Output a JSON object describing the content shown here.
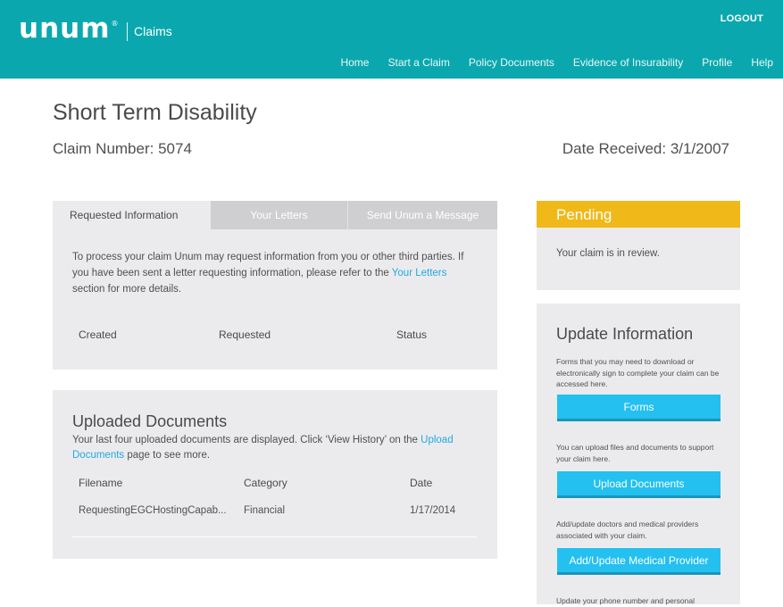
{
  "header": {
    "logo_text": "unum",
    "logo_mark": "®",
    "app_name": "Claims",
    "logout": "LOGOUT",
    "nav": [
      "Home",
      "Start a Claim",
      "Policy Documents",
      "Evidence of Insurability",
      "Profile",
      "Help"
    ]
  },
  "claim": {
    "title": "Short Term Disability",
    "number_label": "Claim Number: 5074",
    "date_label": "Date Received: 3/1/2007"
  },
  "tabs": [
    "Requested Information",
    "Your Letters",
    "Send Unum a Message"
  ],
  "requested": {
    "text_before": "To process your claim Unum may request information from you or other third parties. If you have been sent a letter requesting information, please refer to the ",
    "link": "Your Letters",
    "text_after": " section for more details.",
    "columns": [
      "Created",
      "Requested",
      "Status"
    ]
  },
  "uploaded": {
    "title": "Uploaded Documents",
    "text_before": "Your last four uploaded documents are displayed. Click ‘View History’ on the ",
    "link": "Upload Documents",
    "text_after": " page to see more.",
    "columns": [
      "Filename",
      "Category",
      "Date"
    ],
    "rows": [
      {
        "filename": "RequestingEGCHostingCapab...",
        "category": "Financial",
        "date": "1/17/2014"
      }
    ]
  },
  "status": {
    "label": "Pending",
    "message": "Your claim is in review.",
    "color": "#f0b818"
  },
  "update": {
    "title": "Update Information",
    "forms_note": "Forms that you may need to download or electronically sign to complete your claim can be accessed here.",
    "forms_button": "Forms",
    "upload_note": "You can upload files and documents to support your claim here.",
    "upload_button": "Upload Documents",
    "provider_note": "Add/update doctors and medical providers associated with your claim.",
    "provider_button": "Add/Update Medical Provider",
    "personal_note": "Update your phone number and personal"
  },
  "colors": {
    "header": "#0aa8ae",
    "button": "#23c0f0",
    "link": "#22a9e0",
    "panel": "#ebebee"
  }
}
